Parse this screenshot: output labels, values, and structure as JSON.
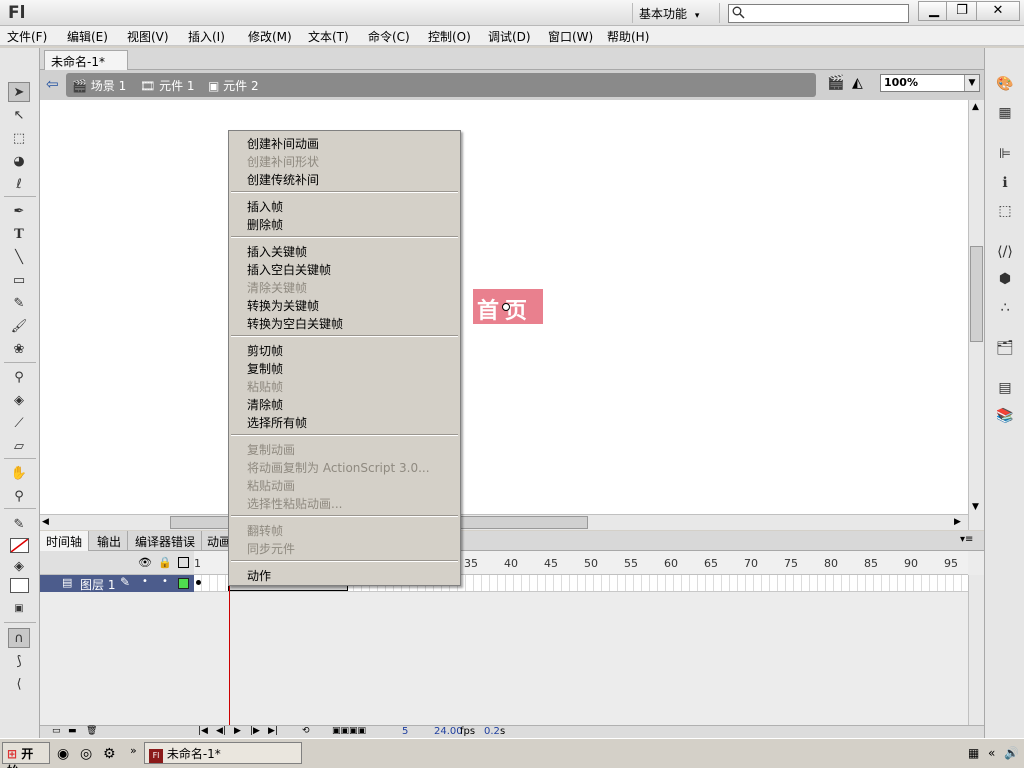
{
  "app": {
    "logo": "Fl",
    "workspace": "基本功能",
    "search_placeholder": "",
    "window_controls": [
      "minimize-icon",
      "restore-icon",
      "close-icon"
    ]
  },
  "menubar": [
    "文件(F)",
    "编辑(E)",
    "视图(V)",
    "插入(I)",
    "修改(M)",
    "文本(T)",
    "命令(C)",
    "控制(O)",
    "调试(D)",
    "窗口(W)",
    "帮助(H)"
  ],
  "document": {
    "tab_title": "未命名-1*",
    "close": "×"
  },
  "editbar": {
    "breadcrumbs": [
      "场景 1",
      "元件 1",
      "元件 2"
    ],
    "zoom": "100%"
  },
  "stage": {
    "symbol_text": "首页",
    "symbol_color": "#e9808e"
  },
  "timeline": {
    "tabs": [
      "时间轴",
      "输出",
      "编译器错误",
      "动画"
    ],
    "layer_name": "图层 1",
    "ruler_ticks": [
      "1",
      "35",
      "40",
      "45",
      "50",
      "55",
      "60",
      "65",
      "70",
      "75",
      "80",
      "85",
      "90",
      "95"
    ],
    "current_frame": "5",
    "fps": "24.00",
    "fps_unit": "fps",
    "time": "0.2",
    "time_unit": "s"
  },
  "context_menu": {
    "groups": [
      [
        {
          "label": "创建补间动画",
          "enabled": true
        },
        {
          "label": "创建补间形状",
          "enabled": false
        },
        {
          "label": "创建传统补间",
          "enabled": true
        }
      ],
      [
        {
          "label": "插入帧",
          "enabled": true
        },
        {
          "label": "删除帧",
          "enabled": true
        }
      ],
      [
        {
          "label": "插入关键帧",
          "enabled": true
        },
        {
          "label": "插入空白关键帧",
          "enabled": true
        },
        {
          "label": "清除关键帧",
          "enabled": false
        },
        {
          "label": "转换为关键帧",
          "enabled": true
        },
        {
          "label": "转换为空白关键帧",
          "enabled": true
        }
      ],
      [
        {
          "label": "剪切帧",
          "enabled": true
        },
        {
          "label": "复制帧",
          "enabled": true
        },
        {
          "label": "粘贴帧",
          "enabled": false
        },
        {
          "label": "清除帧",
          "enabled": true
        },
        {
          "label": "选择所有帧",
          "enabled": true
        }
      ],
      [
        {
          "label": "复制动画",
          "enabled": false
        },
        {
          "label": "将动画复制为 ActionScript 3.0...",
          "enabled": false
        },
        {
          "label": "粘贴动画",
          "enabled": false
        },
        {
          "label": "选择性粘贴动画...",
          "enabled": false
        }
      ],
      [
        {
          "label": "翻转帧",
          "enabled": false
        },
        {
          "label": "同步元件",
          "enabled": false
        }
      ],
      [
        {
          "label": "动作",
          "enabled": true
        }
      ]
    ]
  },
  "taskbar": {
    "start": "开始",
    "task": "未命名-1*"
  }
}
